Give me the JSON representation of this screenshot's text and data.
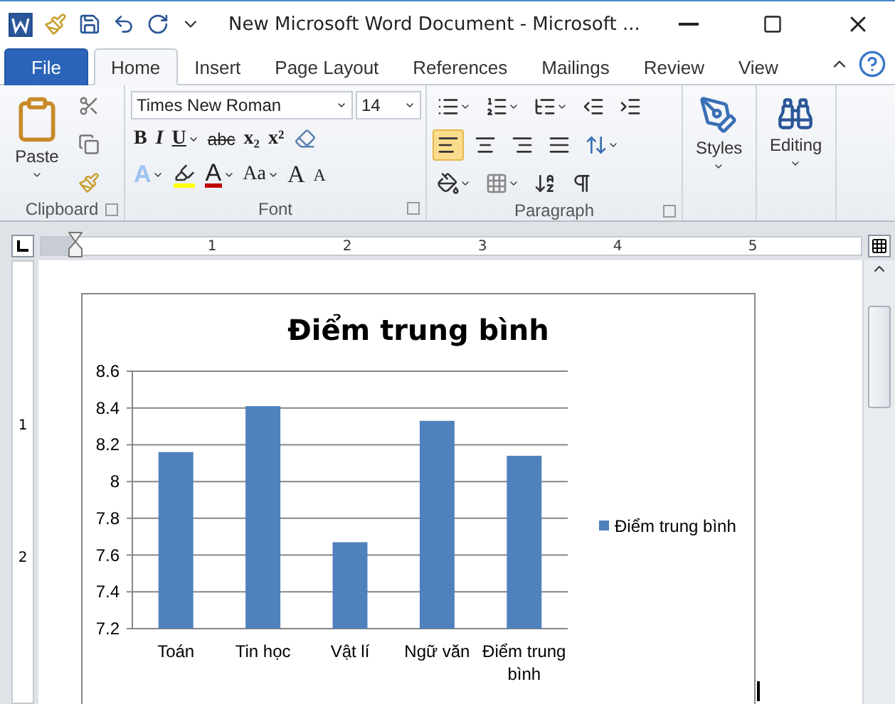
{
  "window": {
    "title": "New Microsoft Word Document  -  Microsoft ..."
  },
  "tabs": [
    {
      "label": "File",
      "selected": false,
      "kind": "file"
    },
    {
      "label": "Home",
      "selected": true,
      "kind": "tab"
    },
    {
      "label": "Insert",
      "selected": false,
      "kind": "tab"
    },
    {
      "label": "Page Layout",
      "selected": false,
      "kind": "tab"
    },
    {
      "label": "References",
      "selected": false,
      "kind": "tab"
    },
    {
      "label": "Mailings",
      "selected": false,
      "kind": "tab"
    },
    {
      "label": "Review",
      "selected": false,
      "kind": "tab"
    },
    {
      "label": "View",
      "selected": false,
      "kind": "tab"
    }
  ],
  "clipboard": {
    "paste_label": "Paste",
    "group_label": "Clipboard"
  },
  "font": {
    "name": "Times New Roman",
    "size": "14",
    "group_label": "Font",
    "row1": [
      {
        "label": "B",
        "kind": "bold",
        "dropdown": false
      },
      {
        "label": "I",
        "kind": "italic",
        "dropdown": false
      },
      {
        "label": "U",
        "kind": "underline",
        "dropdown": true
      },
      {
        "label": "abc",
        "kind": "strike",
        "dropdown": false
      },
      {
        "label": "x₂",
        "kind": "bold",
        "dropdown": false
      },
      {
        "label": "x²",
        "kind": "bold",
        "dropdown": false
      }
    ],
    "row2": [
      {
        "label": "A",
        "kind": "effects",
        "dropdown": true
      },
      {
        "label": "A",
        "kind": "color",
        "dropdown": true
      },
      {
        "label": "Aa",
        "kind": "serif",
        "dropdown": true
      },
      {
        "label": "A",
        "kind": "grow",
        "dropdown": false
      },
      {
        "label": "A",
        "kind": "shrink",
        "dropdown": false
      }
    ]
  },
  "paragraph": {
    "group_label": "Paragraph",
    "alignment": [
      {
        "kind": "left",
        "selected": true
      },
      {
        "kind": "center",
        "selected": false
      },
      {
        "kind": "right",
        "selected": false
      },
      {
        "kind": "justify",
        "selected": false
      }
    ]
  },
  "styles": {
    "label": "Styles"
  },
  "editing": {
    "label": "Editing"
  },
  "ruler": {
    "numbers": [
      "1",
      "2",
      "3",
      "4",
      "5"
    ]
  },
  "vertical_ruler": {
    "numbers": [
      "1",
      "2"
    ]
  },
  "chart": {
    "chart_data": {
      "type": "bar",
      "title": "Điểm trung bình",
      "categories": [
        "Toán",
        "Tin học",
        "Vật lí",
        "Ngữ văn",
        "Điểm trung bình"
      ],
      "series": [
        {
          "name": "Điểm trung bình",
          "color": "#4f81bd",
          "values": [
            8.16,
            8.41,
            7.67,
            8.33,
            8.14
          ]
        }
      ],
      "ylim": [
        7.2,
        8.6
      ],
      "grid": true,
      "yticks": [
        {
          "value": 7.2,
          "label": "7.2"
        },
        {
          "value": 7.4,
          "label": "7.4"
        },
        {
          "value": 7.6,
          "label": "7.6"
        },
        {
          "value": 7.8,
          "label": "7.8"
        },
        {
          "value": 8,
          "label": "8"
        },
        {
          "value": 8.2,
          "label": "8.2"
        },
        {
          "value": 8.4,
          "label": "8.4"
        },
        {
          "value": 8.6,
          "label": "8.6"
        }
      ]
    }
  }
}
